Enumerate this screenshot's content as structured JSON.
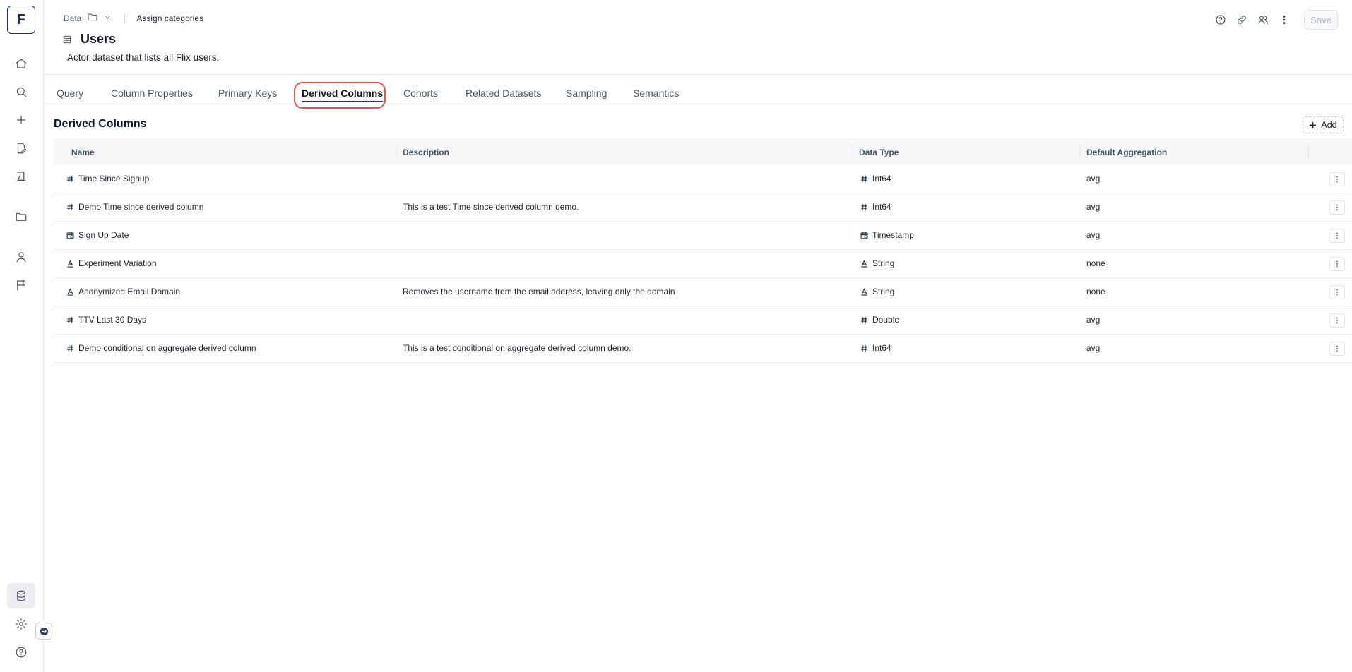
{
  "app": {
    "logo_letter": "F",
    "accent": "#1c2f9b",
    "highlight_color": "#e5534b"
  },
  "sidebar": {
    "items": [
      {
        "icon": "home-icon"
      },
      {
        "icon": "search-icon"
      },
      {
        "icon": "plus-icon"
      },
      {
        "icon": "edit-document-icon"
      },
      {
        "icon": "experiments-icon"
      },
      {
        "icon": "folder-icon"
      },
      {
        "icon": "user-icon"
      },
      {
        "icon": "flag-icon"
      }
    ],
    "bottom": [
      {
        "icon": "database-icon",
        "active": true
      },
      {
        "icon": "gear-icon"
      },
      {
        "icon": "help-icon"
      }
    ]
  },
  "header": {
    "breadcrumb_root": "Data",
    "assign_label": "Assign categories",
    "title": "Users",
    "subtitle": "Actor dataset that lists all Flix users.",
    "save_label": "Save"
  },
  "tabs": [
    {
      "label": "Query",
      "active": false
    },
    {
      "label": "Column Properties",
      "active": false
    },
    {
      "label": "Primary Keys",
      "active": false
    },
    {
      "label": "Derived Columns",
      "active": true
    },
    {
      "label": "Cohorts",
      "active": false
    },
    {
      "label": "Related Datasets",
      "active": false
    },
    {
      "label": "Sampling",
      "active": false
    },
    {
      "label": "Semantics",
      "active": false
    }
  ],
  "section": {
    "title": "Derived Columns",
    "add_label": "Add"
  },
  "table": {
    "columns": [
      "Name",
      "Description",
      "Data Type",
      "Default Aggregation"
    ],
    "rows": [
      {
        "name": "Time Since Signup",
        "name_icon": "number-icon",
        "description": "",
        "type": "Int64",
        "type_icon": "number-icon",
        "agg": "avg"
      },
      {
        "name": "Demo Time since derived column",
        "name_icon": "number-icon",
        "description": "This is a test Time since derived column demo.",
        "type": "Int64",
        "type_icon": "number-icon",
        "agg": "avg"
      },
      {
        "name": "Sign Up Date",
        "name_icon": "calendar-icon",
        "description": "",
        "type": "Timestamp",
        "type_icon": "calendar-icon",
        "agg": "avg"
      },
      {
        "name": "Experiment Variation",
        "name_icon": "string-icon",
        "description": "",
        "type": "String",
        "type_icon": "string-icon",
        "agg": "none"
      },
      {
        "name": "Anonymized Email Domain",
        "name_icon": "string-icon",
        "description": "Removes the username from the email address, leaving only the domain",
        "type": "String",
        "type_icon": "string-icon",
        "agg": "none"
      },
      {
        "name": "TTV Last 30 Days",
        "name_icon": "number-icon",
        "description": "",
        "type": "Double",
        "type_icon": "number-icon",
        "agg": "avg"
      },
      {
        "name": "Demo conditional on aggregate derived column",
        "name_icon": "number-icon",
        "description": "This is a test conditional on aggregate derived column demo.",
        "type": "Int64",
        "type_icon": "number-icon",
        "agg": "avg"
      }
    ]
  }
}
